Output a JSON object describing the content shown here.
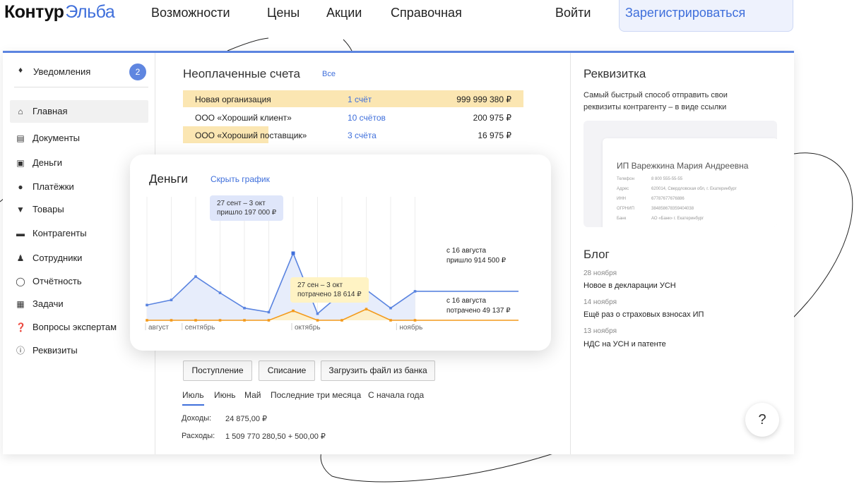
{
  "brand": {
    "part1": "Контур",
    "part2": "Эльба"
  },
  "nav": {
    "items": [
      "Возможности",
      "Цены",
      "Акции",
      "Справочная"
    ],
    "login": "Войти",
    "register": "Зарегистрироваться"
  },
  "sidebar": {
    "notifications": {
      "label": "Уведомления",
      "count": "2"
    },
    "items": [
      {
        "label": "Главная",
        "icon": "home-icon"
      },
      {
        "label": "Документы",
        "icon": "documents-icon"
      },
      {
        "label": "Деньги",
        "icon": "money-icon"
      },
      {
        "label": "Платёжки",
        "icon": "payments-icon"
      },
      {
        "label": "Товары",
        "icon": "cart-icon"
      },
      {
        "label": "Контрагенты",
        "icon": "briefcase-icon"
      },
      {
        "label": "Сотрудники",
        "icon": "person-icon"
      },
      {
        "label": "Отчётность",
        "icon": "report-icon"
      },
      {
        "label": "Задачи",
        "icon": "calendar-icon"
      },
      {
        "label": "Вопросы экспертам",
        "icon": "question-icon"
      },
      {
        "label": "Реквизиты",
        "icon": "info-icon"
      }
    ]
  },
  "unpaid": {
    "title": "Неоплаченные счета",
    "all_link": "Все",
    "rows": [
      {
        "org": "Новая организация",
        "count": "1 счёт",
        "sum": "999 999 380 ₽",
        "bar_fraction": 1.0
      },
      {
        "org": "ООО «Хороший клиент»",
        "count": "10 счётов",
        "sum": "200 975 ₽",
        "bar_fraction": 0.0
      },
      {
        "org": "ООО «Хороший поставщик»",
        "count": "3 счёта",
        "sum": "16 975 ₽",
        "bar_fraction": 0.25
      }
    ]
  },
  "money": {
    "title": "Деньги",
    "hide_link": "Скрыть график",
    "tooltip_in": {
      "line1": "27 сент – 3 окт",
      "line2": "пришло 197 000 ₽"
    },
    "tooltip_out": {
      "line1": "27 сен – 3 окт",
      "line2": "потрачено 18 614 ₽"
    },
    "end_in": {
      "line1": "с 16 августа",
      "line2": "пришло 914 500 ₽"
    },
    "end_out": {
      "line1": "с 16 августа",
      "line2": "потрачено 49 137 ₽"
    }
  },
  "chart_data": {
    "type": "line",
    "x_labels": [
      "август",
      "сентябрь",
      "октябрь",
      "ноябрь"
    ],
    "series": [
      {
        "name": "пришло",
        "values": [
          30,
          40,
          86,
          54,
          24,
          16,
          132,
          13,
          54,
          60,
          24,
          57
        ],
        "color": "#5a84e0"
      },
      {
        "name": "потрачено",
        "values": [
          0,
          0,
          0,
          0,
          0,
          0,
          18.6,
          0,
          0,
          22,
          0,
          0
        ],
        "color": "#f39a1b"
      }
    ],
    "grid": true
  },
  "actions": {
    "income": "Поступление",
    "expense": "Списание",
    "upload": "Загрузить файл из банка"
  },
  "periods": [
    "Июль",
    "Июнь",
    "Май",
    "Последние три месяца",
    "С начала года"
  ],
  "totals": {
    "income_label": "Доходы:",
    "income_value": "24 875,00 ₽",
    "expense_label": "Расходы:",
    "expense_value": "1 509 770 280,50 + 500,00 ₽"
  },
  "requisites": {
    "title": "Реквизитка",
    "desc": "Самый быстрый способ отправить свои реквизиты контрагенту – в виде ссылки",
    "card_name": "ИП Варежкина Мария Андреевна",
    "fields": [
      {
        "key": "Телефон",
        "value": "8 800 555-55-55"
      },
      {
        "key": "Адрес",
        "value": "620014, Свердловская обл, г. Екатеринбург"
      },
      {
        "key": "ИНН",
        "value": "67787677676886"
      },
      {
        "key": "ОГРНИП",
        "value": "384858678359404038"
      },
      {
        "key": "Банк",
        "value": "АО «Банк» г. Екатеринбург"
      }
    ]
  },
  "blog": {
    "title": "Блог",
    "posts": [
      {
        "date": "28 ноября",
        "title": "Новое в декларации УСН"
      },
      {
        "date": "14 ноября",
        "title": "Ещё раз о страховых взносах ИП"
      },
      {
        "date": "13 ноября",
        "title": "НДС на УСН и патенте"
      }
    ]
  },
  "help": "?"
}
